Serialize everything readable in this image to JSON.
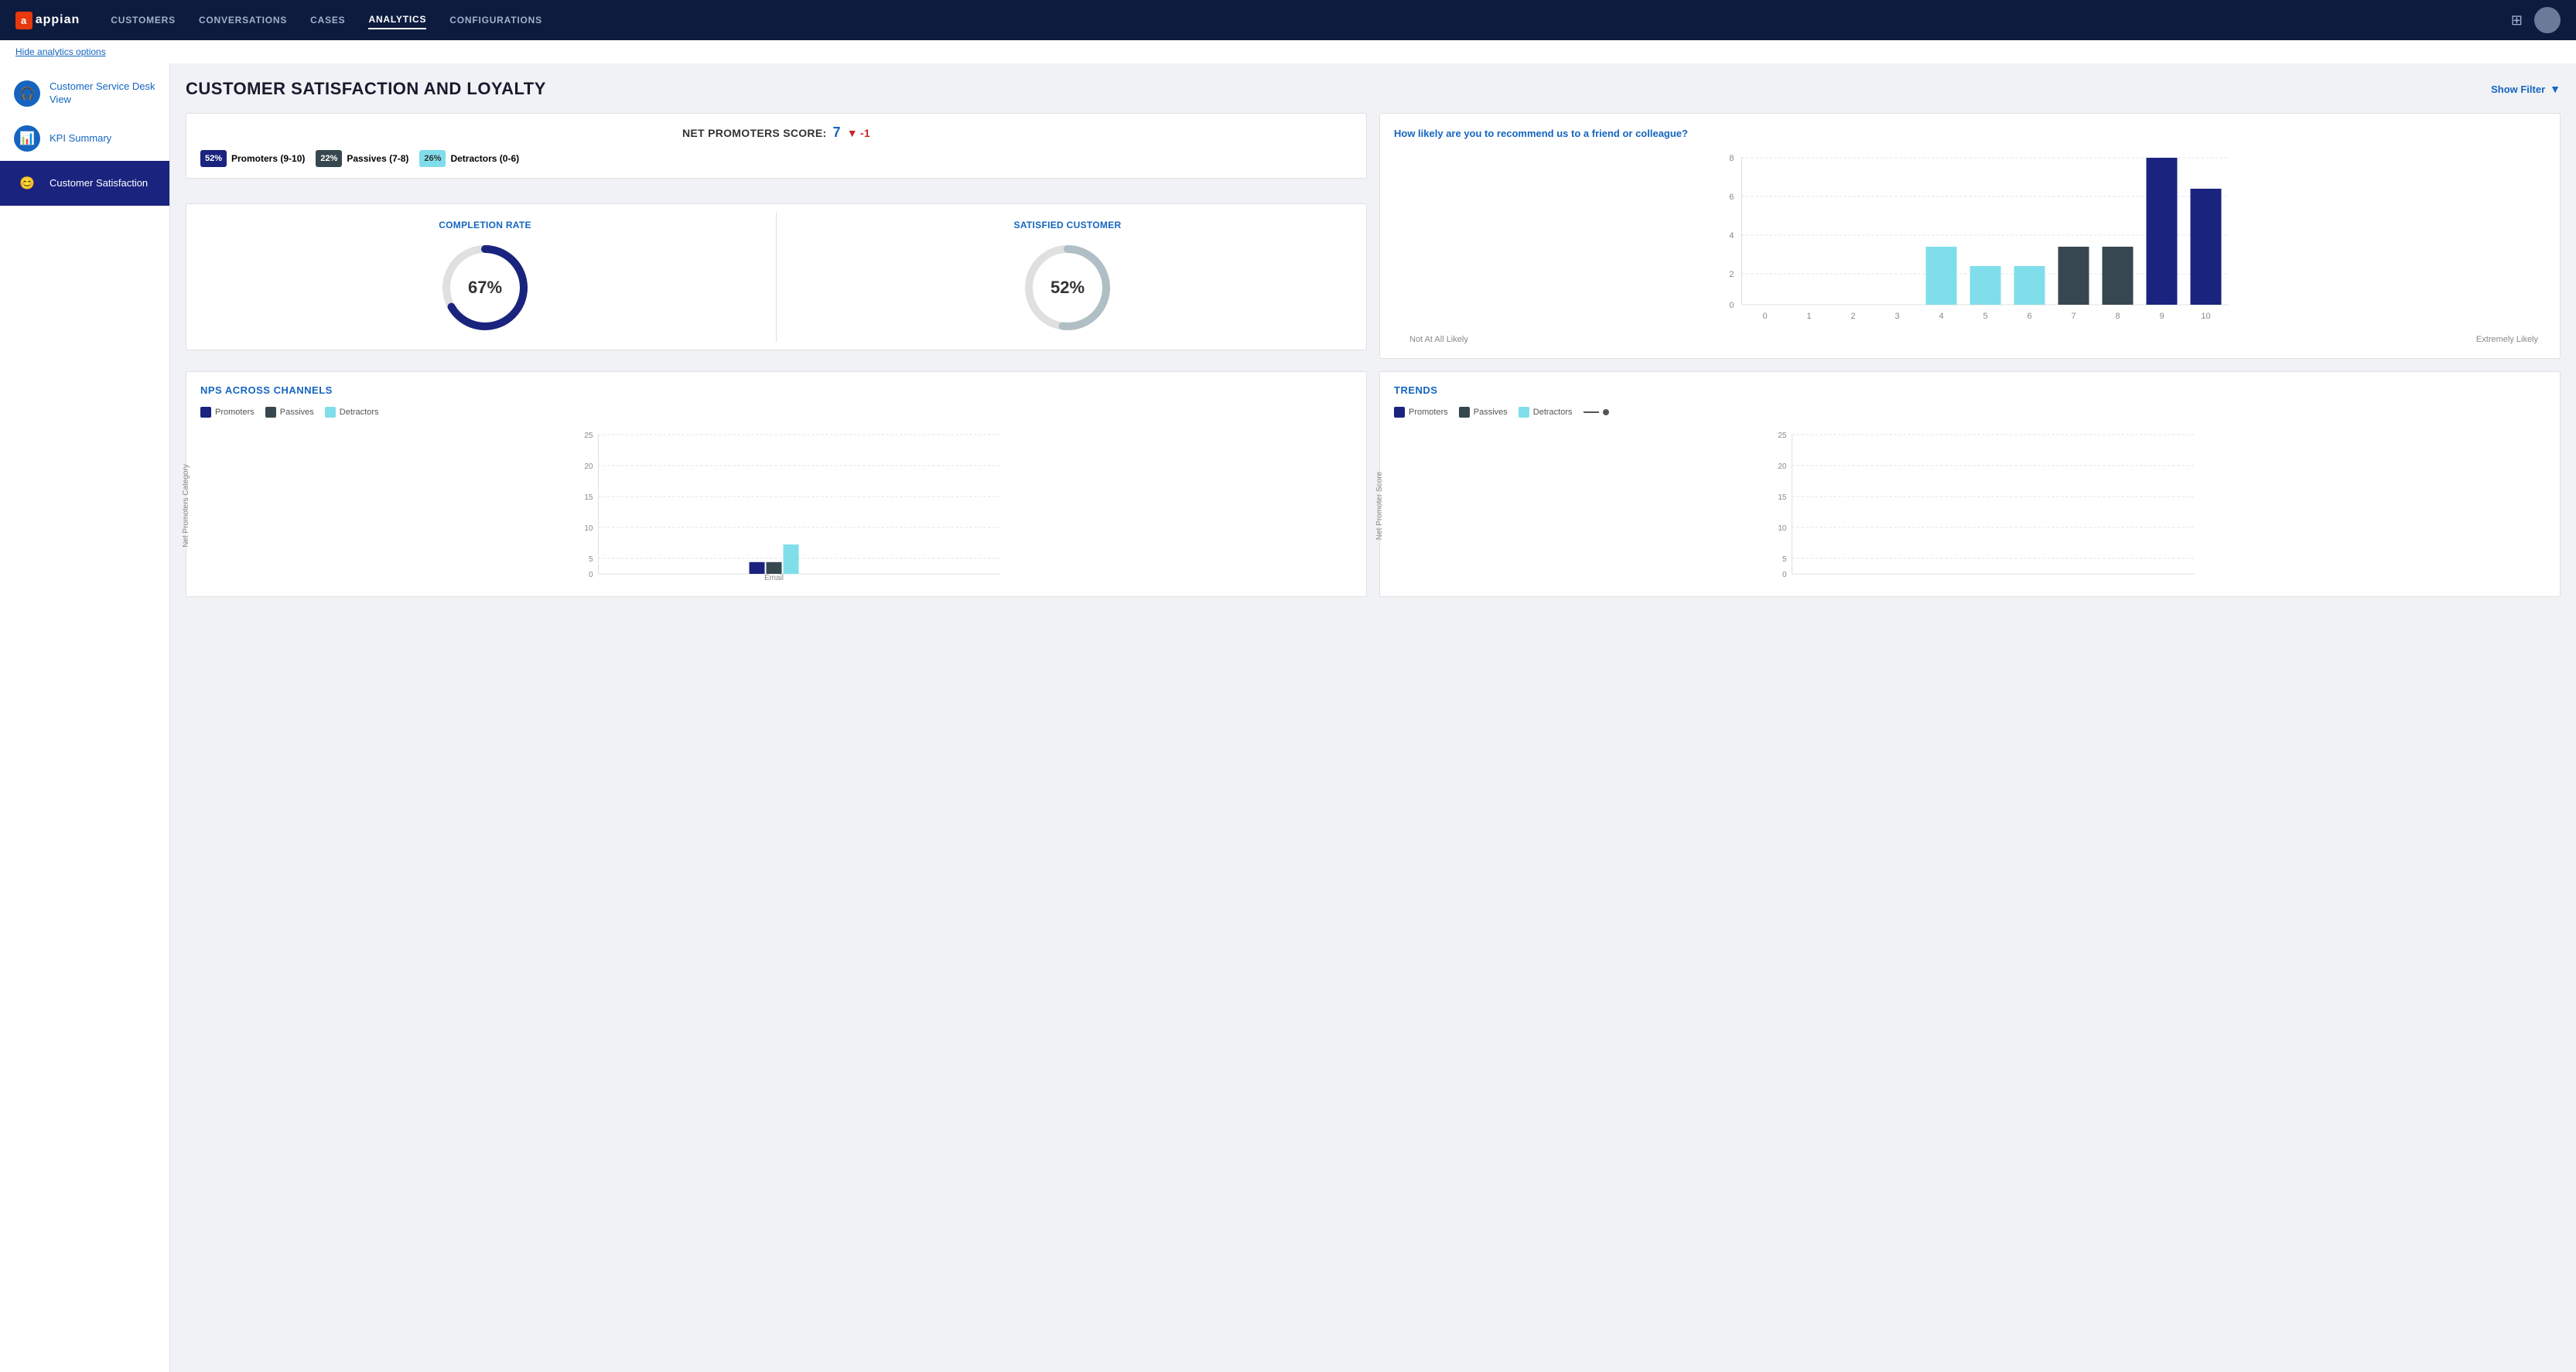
{
  "nav": {
    "logo_text": "appian",
    "links": [
      {
        "label": "CUSTOMERS",
        "active": false
      },
      {
        "label": "CONVERSATIONS",
        "active": false
      },
      {
        "label": "CASES",
        "active": false
      },
      {
        "label": "ANALYTICS",
        "active": true
      },
      {
        "label": "CONFIGURATIONS",
        "active": false
      }
    ],
    "hide_analytics_label": "Hide analytics options",
    "show_filter_label": "Show Filter"
  },
  "sidebar": {
    "items": [
      {
        "label": "Customer Service Desk View",
        "icon": "🎧",
        "active": false
      },
      {
        "label": "KPI Summary",
        "icon": "📊",
        "active": false
      },
      {
        "label": "Customer Satisfaction",
        "icon": "😊",
        "active": true
      }
    ]
  },
  "page": {
    "title": "CUSTOMER SATISFACTION AND LOYALTY"
  },
  "nps": {
    "label": "NET PROMOTERS SCORE:",
    "score": "7",
    "delta": "-1",
    "promoters_pct": "52%",
    "promoters_label": "Promoters (9-10)",
    "passives_pct": "22%",
    "passives_label": "Passives (7-8)",
    "detractors_pct": "26%",
    "detractors_label": "Detractors (0-6)"
  },
  "completion_rate": {
    "title": "COMPLETION RATE",
    "value": "67%",
    "fill_pct": 67
  },
  "satisfied_customer": {
    "title": "SATISFIED CUSTOMER",
    "value": "52%",
    "fill_pct": 52
  },
  "bar_chart": {
    "question": "How likely are you to recommend us to a friend or colleague?",
    "y_max": 8,
    "y_ticks": [
      0,
      2,
      4,
      6,
      8
    ],
    "x_labels": [
      "0",
      "1",
      "2",
      "3",
      "4",
      "5",
      "6",
      "7",
      "8",
      "9",
      "10"
    ],
    "not_at_all": "Not At All Likely",
    "extremely": "Extremely Likely",
    "bars": [
      {
        "x": 0,
        "val": 0,
        "color": "#37474f"
      },
      {
        "x": 1,
        "val": 0,
        "color": "#37474f"
      },
      {
        "x": 2,
        "val": 0,
        "color": "#37474f"
      },
      {
        "x": 3,
        "val": 0,
        "color": "#37474f"
      },
      {
        "x": 4,
        "val": 3,
        "color": "#80deea"
      },
      {
        "x": 5,
        "val": 2,
        "color": "#80deea"
      },
      {
        "x": 6,
        "val": 2,
        "color": "#80deea"
      },
      {
        "x": 7,
        "val": 3,
        "color": "#37474f"
      },
      {
        "x": 8,
        "val": 3,
        "color": "#37474f"
      },
      {
        "x": 9,
        "val": 8,
        "color": "#1a237e"
      },
      {
        "x": 10,
        "val": 6,
        "color": "#1a237e"
      }
    ]
  },
  "nps_channels": {
    "title": "NPS ACROSS CHANNELS",
    "y_label": "Net Promoters Category",
    "legend": [
      {
        "label": "Promoters",
        "color": "#1a237e"
      },
      {
        "label": "Passives",
        "color": "#37474f"
      },
      {
        "label": "Detractors",
        "color": "#80deea"
      }
    ],
    "y_ticks": [
      0,
      5,
      10,
      15,
      20,
      25
    ],
    "bars": [
      {
        "group": "Email",
        "promoters": 2,
        "passives": 2,
        "detractors": 5
      }
    ]
  },
  "trends": {
    "title": "TRENDS",
    "y_label": "Net Promoter Score",
    "legend": [
      {
        "label": "Promoters",
        "color": "#1a237e"
      },
      {
        "label": "Passives",
        "color": "#37474f"
      },
      {
        "label": "Detractors",
        "color": "#80deea"
      },
      {
        "label": "",
        "type": "line",
        "color": "#555"
      }
    ],
    "y_ticks": [
      0,
      5,
      10,
      15,
      20,
      25
    ]
  }
}
